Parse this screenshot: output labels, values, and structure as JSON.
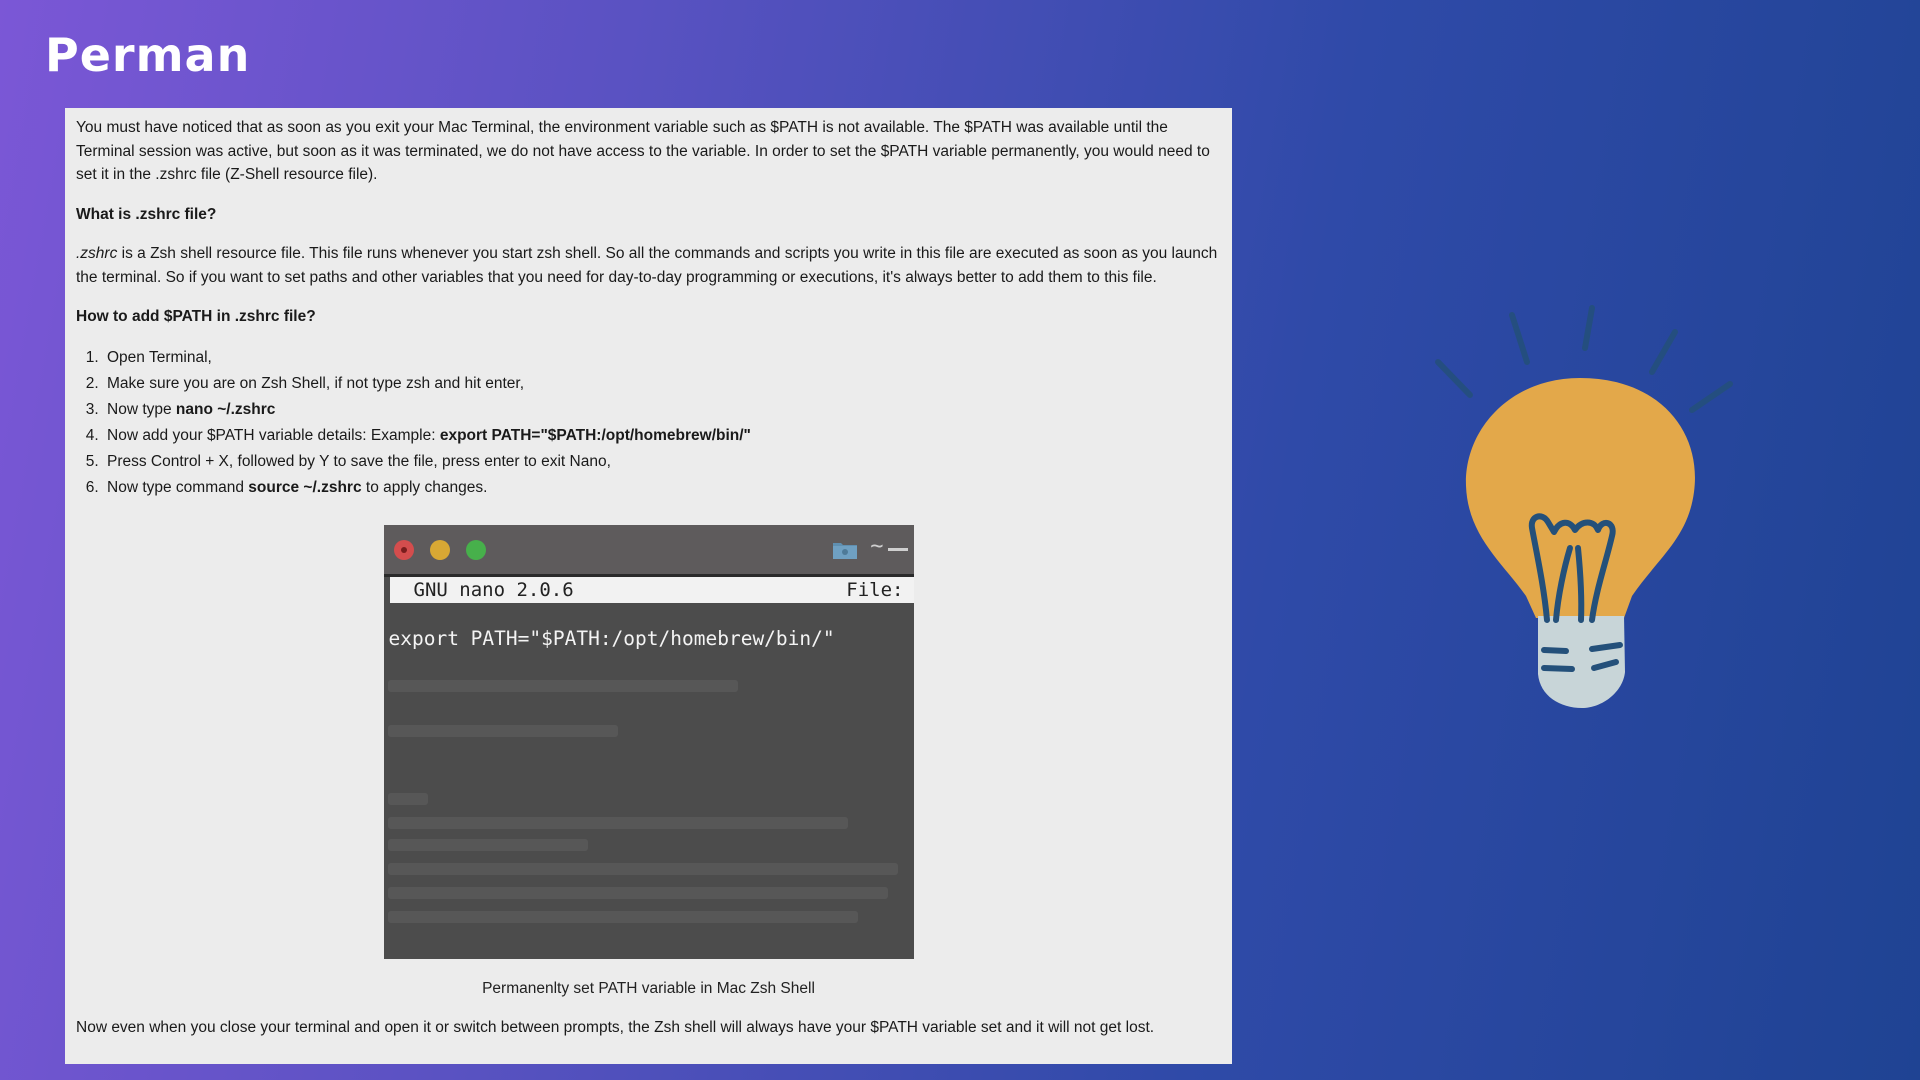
{
  "title": "Perman",
  "article": {
    "intro": "You must have noticed that as soon as you exit your Mac Terminal, the environment variable such as $PATH is not available. The $PATH was available until the Terminal session was active, but soon as it was terminated, we do not have access to the variable. In order to set the $PATH variable permanently, you would need to set it in the .zshrc file (Z-Shell resource file).",
    "heading1": "What is .zshrc file?",
    "para1_em": ".zshrc",
    "para1_rest": " is a Zsh shell resource file. This file runs whenever you start zsh shell. So all the commands and scripts you write in this file are executed as soon as you launch the terminal. So if you want to set paths and other variables that you need for day-to-day programming or executions, it's always better to add them to this file.",
    "heading2": "How to add $PATH in .zshrc file?",
    "steps": [
      {
        "text": "Open Terminal,",
        "bold": "",
        "after": ""
      },
      {
        "text": "Make sure you are on Zsh Shell, if not type zsh and hit enter,",
        "bold": "",
        "after": ""
      },
      {
        "text": "Now type ",
        "bold": "nano ~/.zshrc",
        "after": ""
      },
      {
        "text": "Now add your $PATH variable details: Example: ",
        "bold": "export PATH=\"$PATH:/opt/homebrew/bin/\"",
        "after": ""
      },
      {
        "text": "Press Control + X, followed by Y to save the file, press enter to exit Nano,",
        "bold": "",
        "after": ""
      },
      {
        "text": "Now type command ",
        "bold": "source ~/.zshrc",
        "after": " to apply changes."
      }
    ],
    "terminal": {
      "nano_version": "GNU nano 2.0.6",
      "file_label": "File:",
      "tilde": "~",
      "command": "export PATH=\"$PATH:/opt/homebrew/bin/\""
    },
    "caption": "Permanenlty set PATH variable in Mac Zsh Shell",
    "outro": "Now even when you close your terminal and open it or switch between prompts, the Zsh shell will always have your $PATH variable set and it will not get lost."
  },
  "colors": {
    "bulb": "#e3a84a",
    "bulb_base": "#c8d5d8",
    "bulb_stroke": "#24507a"
  },
  "icons": {
    "bulb": "lightbulb-icon",
    "folder": "folder-icon"
  }
}
